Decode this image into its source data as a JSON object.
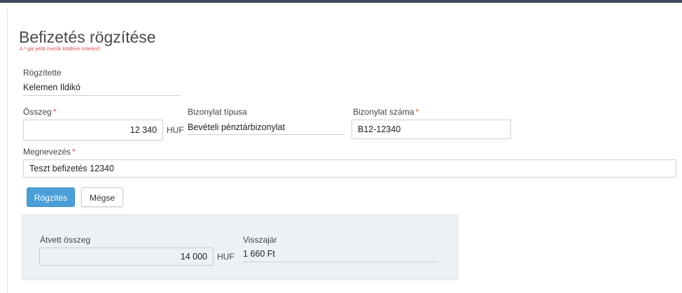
{
  "form": {
    "title": "Befizetés rögzítése",
    "required_hint": "A *-gal jelölt mezők kitöltése kötelező",
    "recorded_by": {
      "label": "Rögzítette",
      "value": "Kelemen Ildikó"
    },
    "amount": {
      "label": "Összeg",
      "required_mark": "*",
      "value": "12 340",
      "unit": "HUF"
    },
    "document_type": {
      "label": "Bizonylat típusa",
      "value": "Bevételi pénztárbizonylat"
    },
    "document_number": {
      "label": "Bizonylat száma",
      "required_mark": "*",
      "value": "B12-12340"
    },
    "description": {
      "label": "Megnevezés",
      "required_mark": "*",
      "value": "Teszt befizetés 12340"
    }
  },
  "buttons": {
    "save_label": "Rögzítés",
    "cancel_label": "Mégse"
  },
  "cash": {
    "received": {
      "label": "Átvett összeg",
      "value": "14 000",
      "unit": "HUF"
    },
    "change": {
      "label": "Visszajár",
      "value": "1 660 Ft"
    }
  },
  "colors": {
    "primary": "#4a9fd6",
    "required": "#d9534f",
    "topbar": "#3d4b5a",
    "cash_panel_bg": "#eef1f4"
  }
}
